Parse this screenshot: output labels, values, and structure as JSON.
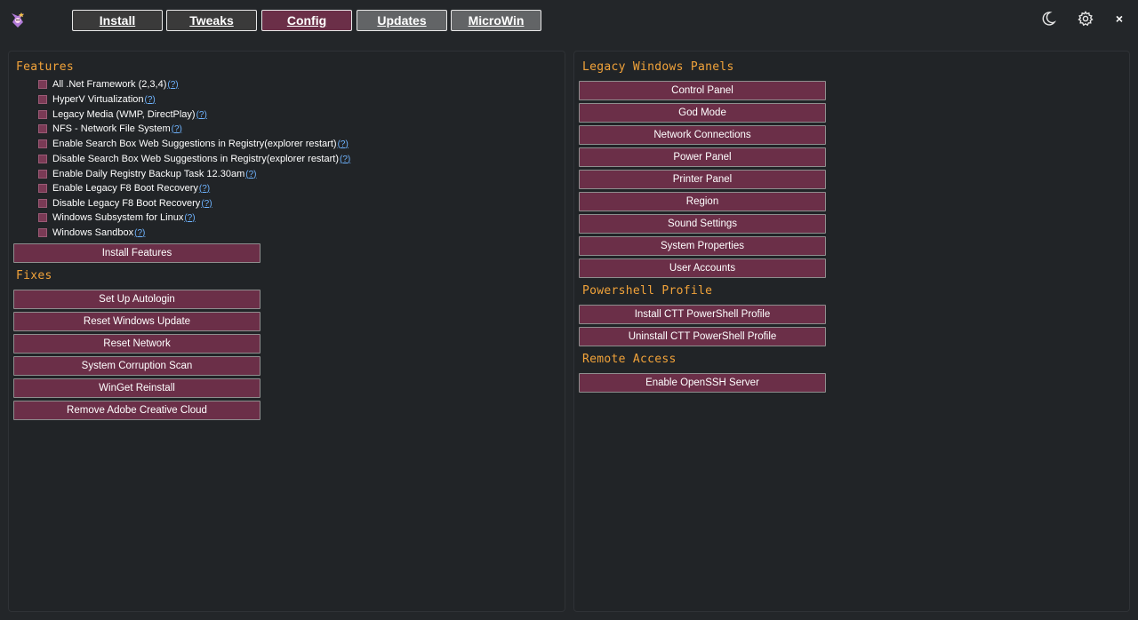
{
  "header": {
    "tabs": [
      {
        "label": "Install"
      },
      {
        "label": "Tweaks"
      },
      {
        "label": "Config"
      },
      {
        "label": "Updates"
      },
      {
        "label": "MicroWin"
      }
    ],
    "active_tab": "Config",
    "icons": {
      "theme": "moon-icon",
      "settings": "gear-icon",
      "close": "close-icon"
    },
    "close_label": "×"
  },
  "colors": {
    "background": "#232629",
    "accent": "#6b2f48",
    "section_title": "#f2a33a",
    "help_link": "#6fb4ff"
  },
  "features": {
    "title": "Features",
    "items": [
      {
        "label": "All .Net Framework (2,3,4)",
        "help": "(?)"
      },
      {
        "label": "HyperV Virtualization",
        "help": "(?)"
      },
      {
        "label": "Legacy Media (WMP, DirectPlay)",
        "help": "(?)"
      },
      {
        "label": "NFS - Network File System",
        "help": "(?)"
      },
      {
        "label": "Enable Search Box Web Suggestions in Registry(explorer restart)",
        "help": "(?)"
      },
      {
        "label": "Disable Search Box Web Suggestions in Registry(explorer restart)",
        "help": "(?)"
      },
      {
        "label": "Enable Daily Registry Backup Task 12.30am",
        "help": "(?)"
      },
      {
        "label": "Enable Legacy F8 Boot Recovery",
        "help": "(?)"
      },
      {
        "label": "Disable Legacy F8 Boot Recovery",
        "help": "(?)"
      },
      {
        "label": "Windows Subsystem for Linux",
        "help": "(?)"
      },
      {
        "label": "Windows Sandbox",
        "help": "(?)"
      }
    ],
    "install_button": "Install Features"
  },
  "fixes": {
    "title": "Fixes",
    "buttons": [
      "Set Up Autologin",
      "Reset Windows Update",
      "Reset Network",
      "System Corruption Scan",
      "WinGet Reinstall",
      "Remove Adobe Creative Cloud"
    ]
  },
  "legacy_panels": {
    "title": "Legacy Windows Panels",
    "buttons": [
      "Control Panel",
      "God Mode",
      "Network Connections",
      "Power Panel",
      "Printer Panel",
      "Region",
      "Sound Settings",
      "System Properties",
      "User Accounts"
    ]
  },
  "powershell_profile": {
    "title": "Powershell Profile",
    "buttons": [
      "Install CTT PowerShell Profile",
      "Uninstall CTT PowerShell Profile"
    ]
  },
  "remote_access": {
    "title": "Remote Access",
    "buttons": [
      "Enable OpenSSH Server"
    ]
  }
}
